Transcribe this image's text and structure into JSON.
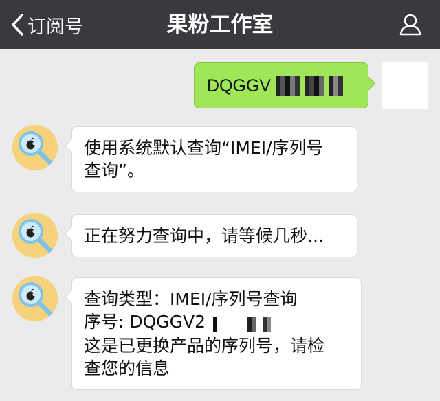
{
  "header": {
    "back_label": "订阅号",
    "title": "果粉工作室"
  },
  "messages": {
    "sent": {
      "text": "DQGGV"
    },
    "m1": {
      "line1": "使用系统默认查询“IMEI/序列号",
      "line2": "查询”。"
    },
    "m2": {
      "line1": "正在努力查询中，请等候几秒..."
    },
    "m3": {
      "line1": "查询类型：IMEI/序列号查询",
      "line2": "序号: DQGGV2",
      "line3": "这是已更换产品的序列号，请检",
      "line4": "查您的信息"
    }
  },
  "icons": {
    "back": "chevron-left-icon",
    "user": "user-profile-icon",
    "bot_avatar": "apple-magnifier-icon"
  },
  "colors": {
    "navbar": "#393a3f",
    "background": "#ebebeb",
    "sent_bubble": "#9fe658",
    "received_bubble": "#ffffff",
    "avatar": "#f7d27c"
  }
}
